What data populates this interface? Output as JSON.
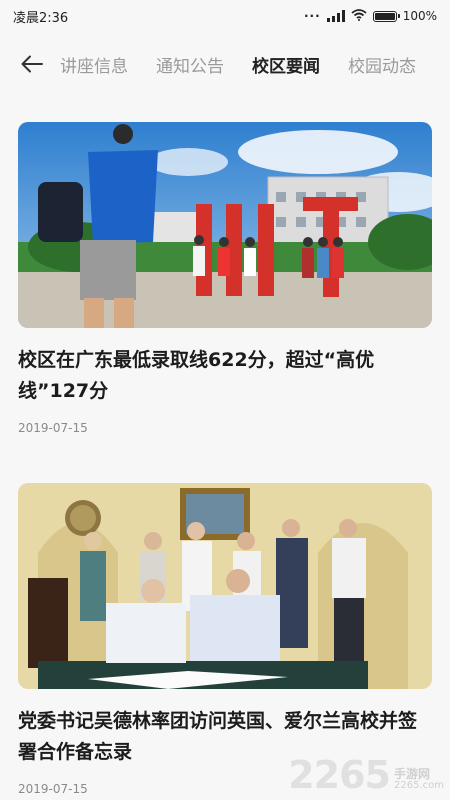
{
  "status": {
    "time": "凌晨2:36",
    "battery": "100%",
    "battery_level": 1.0
  },
  "nav": {
    "tabs": [
      {
        "label": "讲座信息"
      },
      {
        "label": "通知公告"
      },
      {
        "label": "校区要闻"
      },
      {
        "label": "校园动态"
      }
    ],
    "active_index": 2
  },
  "articles": [
    {
      "title": "校区在广东最低录取线622分，超过“高优线”127分",
      "date": "2019-07-15"
    },
    {
      "title": "党委书记吴德林率团访问英国、爱尔兰高校并签署合作备忘录",
      "date": "2019-07-15"
    }
  ],
  "watermark": {
    "number": "2265",
    "site_top": "手游网",
    "site_bottom": "2265.com"
  }
}
